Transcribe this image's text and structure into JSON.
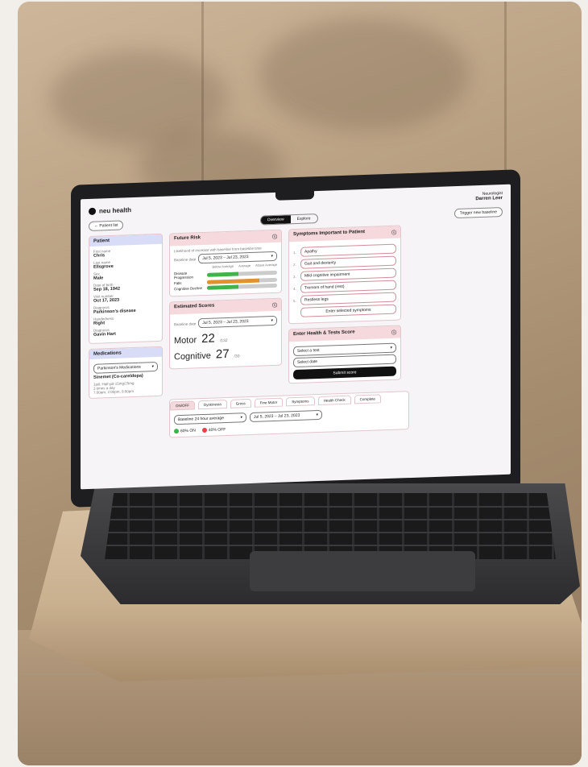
{
  "app": {
    "brand": "neu health",
    "user_role": "Neurologist",
    "user_name": "Darren Leer",
    "trigger_btn": "Trigger new baseline"
  },
  "nav": {
    "back": "← Patient list",
    "toggle": [
      "Overview",
      "Explore"
    ],
    "active_toggle": 0
  },
  "patient": {
    "title": "Patient",
    "fields": [
      {
        "label": "First name",
        "value": "Chris"
      },
      {
        "label": "Last name",
        "value": "Ellsgrove"
      },
      {
        "label": "Sex",
        "value": "Male"
      },
      {
        "label": "Date of birth",
        "value": "Sep 18, 1942"
      },
      {
        "label": "Visit number",
        "value": "Oct 17, 2023"
      },
      {
        "label": "Diagnosis",
        "value": "Parkinson's disease"
      },
      {
        "label": "Handedness",
        "value": "Right"
      },
      {
        "label": "Diagnosis",
        "value": "Gavin Hart"
      }
    ]
  },
  "medications": {
    "title": "Medications",
    "select": "Parkinson's Medications",
    "items": [
      "Sinemet (Co-careldopa)",
      "1pill, Half-pill 15mg/25mg",
      "3 times a day",
      "7:00am, 2:00pm, 9:00pm"
    ]
  },
  "future_risk": {
    "title": "Future Risk",
    "subtitle": "Likelihood of increase with baseline from baseline time",
    "select_label": "Baseline date",
    "select_value": "Jul 5, 2023 – Jul 23, 2023",
    "col_headers": [
      "Below Average",
      "Average",
      "Above Average"
    ],
    "rows": [
      {
        "label": "Disease Progression",
        "value": 0.45,
        "color": "#3fb44a"
      },
      {
        "label": "Falls",
        "value": 0.75,
        "color": "#e2922b"
      },
      {
        "label": "Cognitive Decline",
        "value": 0.45,
        "color": "#3fb44a"
      }
    ]
  },
  "symptoms": {
    "title": "Symptoms Important to Patient",
    "items": [
      "Apathy",
      "Gait and dexterity",
      "Mild cognitive impairment",
      "Tremors of hand (rest)",
      "Restless legs"
    ],
    "btn": "Enter selected symptoms"
  },
  "scores": {
    "title": "Estimated Scores",
    "select_label": "Baseline date",
    "select_value": "Jul 5, 2023 – Jul 23, 2023",
    "motor_label": "Motor",
    "motor_value": "22",
    "motor_max": "/132",
    "cog_label": "Cognitive",
    "cog_value": "27",
    "cog_max": "/30"
  },
  "health_form": {
    "title": "Enter Health & Tests Score",
    "select1": "Select a test",
    "select2": "Select date",
    "btn": "Submit score"
  },
  "tabs": [
    "ON/OFF",
    "Dyskinesia",
    "Gross",
    "Fine Motor",
    "Symptoms",
    "Health Check",
    "Complete"
  ],
  "bottom": {
    "select1": "Baseline 24 hour average",
    "select2": "Jul 5, 2023 – Jul 23, 2023",
    "legend_on": "60% ON",
    "legend_off": "40% OFF",
    "on_color": "#3fb44a",
    "off_color": "#e04646"
  }
}
